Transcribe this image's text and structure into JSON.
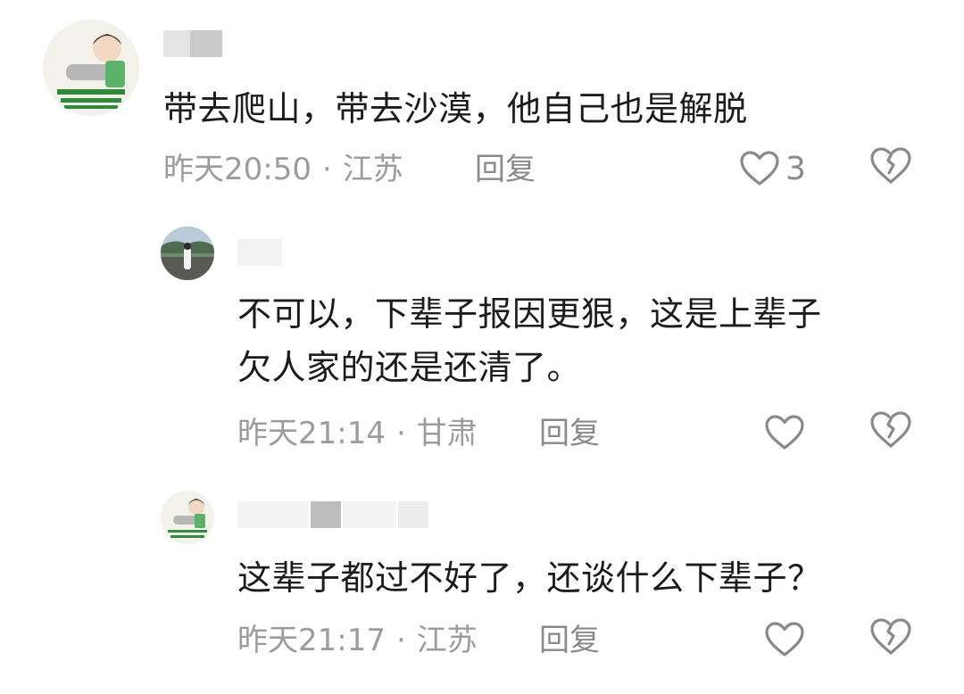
{
  "comments": [
    {
      "text": "带去爬山，带去沙漠，他自己也是解脱",
      "time": "昨天20:50",
      "location": "江苏",
      "reply_label": "回复",
      "like_count": "3"
    },
    {
      "text": "不可以，下辈子报因更狠，这是上辈子\n欠人家的还是还清了。",
      "time": "昨天21:14",
      "location": "甘肃",
      "reply_label": "回复",
      "like_count": ""
    },
    {
      "text": "这辈子都过不好了，还谈什么下辈子？",
      "time": "昨天21:17",
      "location": "江苏",
      "reply_label": "回复",
      "like_count": ""
    }
  ],
  "meta_separator": "·",
  "icons": {
    "like": "heart-outline-icon",
    "dislike": "broken-heart-icon"
  },
  "colors": {
    "text": "#1c1c1c",
    "meta": "#9c9c9c",
    "icon": "#8a8a8a",
    "blur": "#c8c8c8"
  }
}
